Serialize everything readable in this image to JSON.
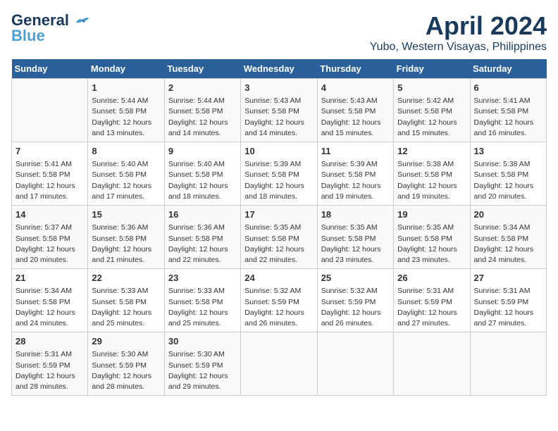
{
  "logo": {
    "line1": "General",
    "line2": "Blue"
  },
  "title": "April 2024",
  "subtitle": "Yubo, Western Visayas, Philippines",
  "days_of_week": [
    "Sunday",
    "Monday",
    "Tuesday",
    "Wednesday",
    "Thursday",
    "Friday",
    "Saturday"
  ],
  "weeks": [
    [
      {
        "day": "",
        "info": ""
      },
      {
        "day": "1",
        "info": "Sunrise: 5:44 AM\nSunset: 5:58 PM\nDaylight: 12 hours\nand 13 minutes."
      },
      {
        "day": "2",
        "info": "Sunrise: 5:44 AM\nSunset: 5:58 PM\nDaylight: 12 hours\nand 14 minutes."
      },
      {
        "day": "3",
        "info": "Sunrise: 5:43 AM\nSunset: 5:58 PM\nDaylight: 12 hours\nand 14 minutes."
      },
      {
        "day": "4",
        "info": "Sunrise: 5:43 AM\nSunset: 5:58 PM\nDaylight: 12 hours\nand 15 minutes."
      },
      {
        "day": "5",
        "info": "Sunrise: 5:42 AM\nSunset: 5:58 PM\nDaylight: 12 hours\nand 15 minutes."
      },
      {
        "day": "6",
        "info": "Sunrise: 5:41 AM\nSunset: 5:58 PM\nDaylight: 12 hours\nand 16 minutes."
      }
    ],
    [
      {
        "day": "7",
        "info": "Sunrise: 5:41 AM\nSunset: 5:58 PM\nDaylight: 12 hours\nand 17 minutes."
      },
      {
        "day": "8",
        "info": "Sunrise: 5:40 AM\nSunset: 5:58 PM\nDaylight: 12 hours\nand 17 minutes."
      },
      {
        "day": "9",
        "info": "Sunrise: 5:40 AM\nSunset: 5:58 PM\nDaylight: 12 hours\nand 18 minutes."
      },
      {
        "day": "10",
        "info": "Sunrise: 5:39 AM\nSunset: 5:58 PM\nDaylight: 12 hours\nand 18 minutes."
      },
      {
        "day": "11",
        "info": "Sunrise: 5:39 AM\nSunset: 5:58 PM\nDaylight: 12 hours\nand 19 minutes."
      },
      {
        "day": "12",
        "info": "Sunrise: 5:38 AM\nSunset: 5:58 PM\nDaylight: 12 hours\nand 19 minutes."
      },
      {
        "day": "13",
        "info": "Sunrise: 5:38 AM\nSunset: 5:58 PM\nDaylight: 12 hours\nand 20 minutes."
      }
    ],
    [
      {
        "day": "14",
        "info": "Sunrise: 5:37 AM\nSunset: 5:58 PM\nDaylight: 12 hours\nand 20 minutes."
      },
      {
        "day": "15",
        "info": "Sunrise: 5:36 AM\nSunset: 5:58 PM\nDaylight: 12 hours\nand 21 minutes."
      },
      {
        "day": "16",
        "info": "Sunrise: 5:36 AM\nSunset: 5:58 PM\nDaylight: 12 hours\nand 22 minutes."
      },
      {
        "day": "17",
        "info": "Sunrise: 5:35 AM\nSunset: 5:58 PM\nDaylight: 12 hours\nand 22 minutes."
      },
      {
        "day": "18",
        "info": "Sunrise: 5:35 AM\nSunset: 5:58 PM\nDaylight: 12 hours\nand 23 minutes."
      },
      {
        "day": "19",
        "info": "Sunrise: 5:35 AM\nSunset: 5:58 PM\nDaylight: 12 hours\nand 23 minutes."
      },
      {
        "day": "20",
        "info": "Sunrise: 5:34 AM\nSunset: 5:58 PM\nDaylight: 12 hours\nand 24 minutes."
      }
    ],
    [
      {
        "day": "21",
        "info": "Sunrise: 5:34 AM\nSunset: 5:58 PM\nDaylight: 12 hours\nand 24 minutes."
      },
      {
        "day": "22",
        "info": "Sunrise: 5:33 AM\nSunset: 5:58 PM\nDaylight: 12 hours\nand 25 minutes."
      },
      {
        "day": "23",
        "info": "Sunrise: 5:33 AM\nSunset: 5:58 PM\nDaylight: 12 hours\nand 25 minutes."
      },
      {
        "day": "24",
        "info": "Sunrise: 5:32 AM\nSunset: 5:59 PM\nDaylight: 12 hours\nand 26 minutes."
      },
      {
        "day": "25",
        "info": "Sunrise: 5:32 AM\nSunset: 5:59 PM\nDaylight: 12 hours\nand 26 minutes."
      },
      {
        "day": "26",
        "info": "Sunrise: 5:31 AM\nSunset: 5:59 PM\nDaylight: 12 hours\nand 27 minutes."
      },
      {
        "day": "27",
        "info": "Sunrise: 5:31 AM\nSunset: 5:59 PM\nDaylight: 12 hours\nand 27 minutes."
      }
    ],
    [
      {
        "day": "28",
        "info": "Sunrise: 5:31 AM\nSunset: 5:59 PM\nDaylight: 12 hours\nand 28 minutes."
      },
      {
        "day": "29",
        "info": "Sunrise: 5:30 AM\nSunset: 5:59 PM\nDaylight: 12 hours\nand 28 minutes."
      },
      {
        "day": "30",
        "info": "Sunrise: 5:30 AM\nSunset: 5:59 PM\nDaylight: 12 hours\nand 29 minutes."
      },
      {
        "day": "",
        "info": ""
      },
      {
        "day": "",
        "info": ""
      },
      {
        "day": "",
        "info": ""
      },
      {
        "day": "",
        "info": ""
      }
    ]
  ]
}
